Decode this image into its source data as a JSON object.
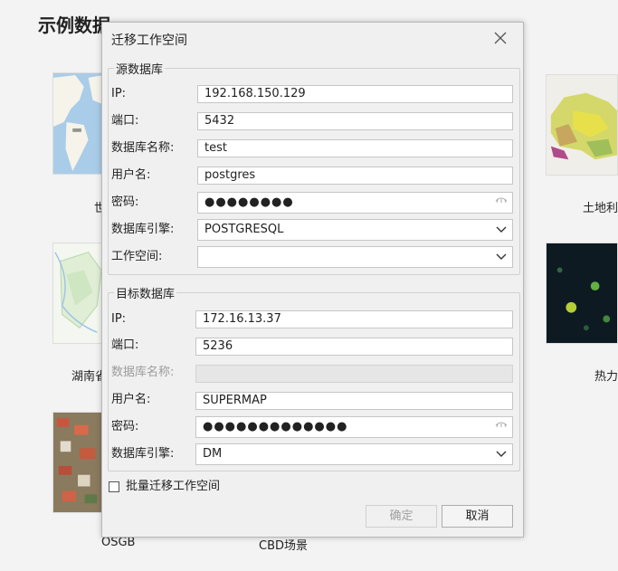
{
  "background": {
    "title": "示例数据",
    "captions": {
      "world_partial": "世",
      "land_use_partial": "土地利",
      "hunan_partial": "湖南省",
      "heat_partial": "热力",
      "osgb": "OSGB",
      "cbd": "CBD场景"
    }
  },
  "dialog": {
    "title": "迁移工作空间",
    "source": {
      "legend": "源数据库",
      "ip_label": "IP:",
      "ip_value": "192.168.150.129",
      "port_label": "端口:",
      "port_value": "5432",
      "dbname_label": "数据库名称:",
      "dbname_value": "test",
      "user_label": "用户名:",
      "user_value": "postgres",
      "password_label": "密码:",
      "password_value": "●●●●●●●●",
      "engine_label": "数据库引擎:",
      "engine_value": "POSTGRESQL",
      "workspace_label": "工作空间:",
      "workspace_value": ""
    },
    "target": {
      "legend": "目标数据库",
      "ip_label": "IP:",
      "ip_value": "172.16.13.37",
      "port_label": "端口:",
      "port_value": "5236",
      "dbname_label": "数据库名称:",
      "dbname_value": "",
      "user_label": "用户名:",
      "user_value": "SUPERMAP",
      "password_label": "密码:",
      "password_value": "●●●●●●●●●●●●●",
      "engine_label": "数据库引擎:",
      "engine_value": "DM"
    },
    "batch_label": "批量迁移工作空间",
    "ok_label": "确定",
    "cancel_label": "取消"
  }
}
